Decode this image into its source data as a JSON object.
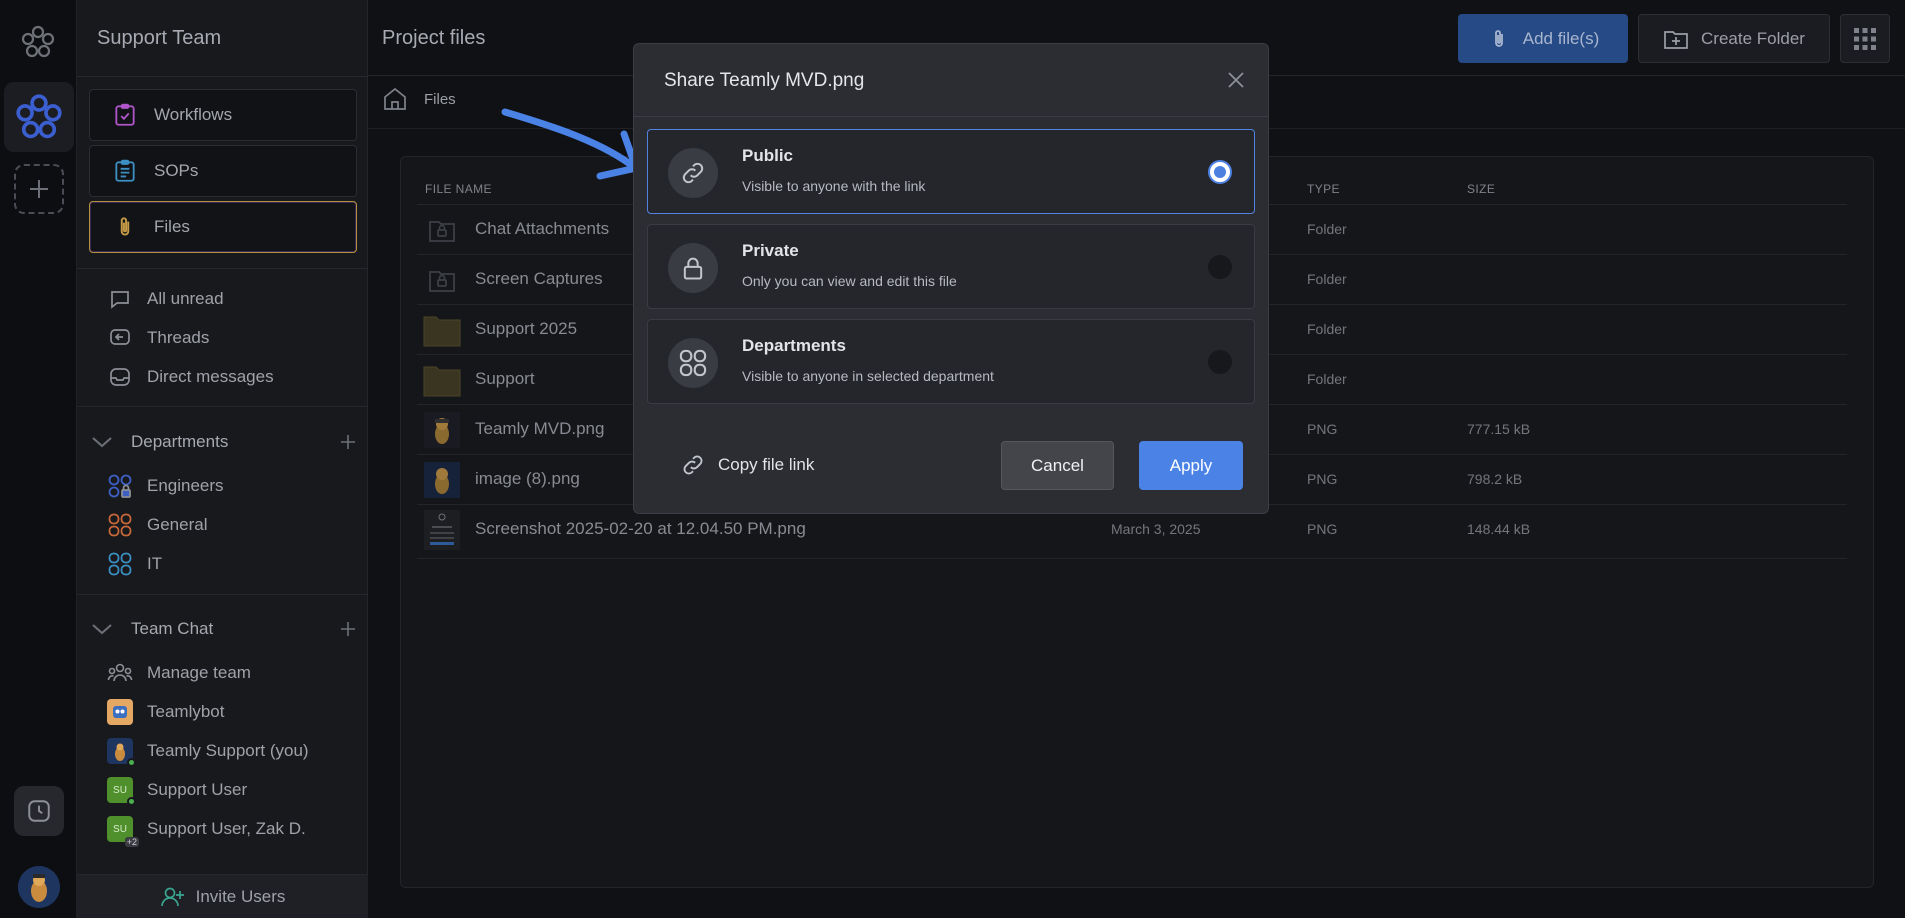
{
  "rail": {
    "icons": [
      "teamly-logo-icon",
      "team-workspace-icon",
      "add-workspace-icon",
      "clock-icon",
      "user-avatar"
    ]
  },
  "sidebar": {
    "team_name": "Support Team",
    "nav": [
      {
        "label": "Workflows",
        "icon": "clipboard-check-icon",
        "active": false
      },
      {
        "label": "SOPs",
        "icon": "clipboard-list-icon",
        "active": false
      },
      {
        "label": "Files",
        "icon": "paperclip-icon",
        "active": true
      }
    ],
    "quick": [
      {
        "label": "All unread",
        "icon": "chat-bubble-icon"
      },
      {
        "label": "Threads",
        "icon": "threads-icon"
      },
      {
        "label": "Direct messages",
        "icon": "inbox-icon"
      }
    ],
    "departments": {
      "title": "Departments",
      "items": [
        {
          "label": "Engineers",
          "color": "#3d5fc4"
        },
        {
          "label": "General",
          "color": "#c7683a"
        },
        {
          "label": "IT",
          "color": "#3c8fc2"
        }
      ]
    },
    "team_chat": {
      "title": "Team Chat",
      "items": [
        {
          "label": "Manage team"
        },
        {
          "label": "Teamlybot"
        },
        {
          "label": "Teamly Support (you)"
        },
        {
          "label": "Support User",
          "initials": "SU"
        },
        {
          "label": "Support User, Zak D.",
          "initials": "SU",
          "extra": "+2"
        }
      ]
    },
    "invite_label": "Invite Users"
  },
  "main": {
    "title": "Project files",
    "add_files_label": "Add file(s)",
    "create_folder_label": "Create Folder",
    "breadcrumb": "Files",
    "columns": {
      "name": "FILE NAME",
      "type": "TYPE",
      "size": "SIZE"
    },
    "rows": [
      {
        "name": "Chat Attachments",
        "date": "",
        "type": "Folder",
        "size": "",
        "kind": "locked-folder"
      },
      {
        "name": "Screen Captures",
        "date": "",
        "type": "Folder",
        "size": "",
        "kind": "locked-folder"
      },
      {
        "name": "Support 2025",
        "date": "",
        "type": "Folder",
        "size": "",
        "kind": "folder"
      },
      {
        "name": "Support",
        "date": "",
        "type": "Folder",
        "size": "",
        "kind": "folder"
      },
      {
        "name": "Teamly MVD.png",
        "date": "",
        "type": "PNG",
        "size": "777.15 kB",
        "kind": "image"
      },
      {
        "name": "image (8).png",
        "date": "",
        "type": "PNG",
        "size": "798.2 kB",
        "kind": "image"
      },
      {
        "name": "Screenshot 2025-02-20 at 12.04.50 PM.png",
        "date": "March 3, 2025",
        "type": "PNG",
        "size": "148.44 kB",
        "kind": "screenshot"
      }
    ]
  },
  "modal": {
    "title": "Share Teamly MVD.png",
    "options": [
      {
        "title": "Public",
        "desc": "Visible to anyone with the link",
        "icon": "link-icon",
        "selected": true
      },
      {
        "title": "Private",
        "desc": "Only you can view and edit this file",
        "icon": "lock-icon",
        "selected": false
      },
      {
        "title": "Departments",
        "desc": "Visible to anyone in selected department",
        "icon": "departments-icon",
        "selected": false
      }
    ],
    "copy_link_label": "Copy file link",
    "cancel_label": "Cancel",
    "apply_label": "Apply"
  },
  "colors": {
    "accent": "#4a82e6",
    "active_border": "#b78f3f",
    "annotation_arrow": "#4a82e6"
  }
}
